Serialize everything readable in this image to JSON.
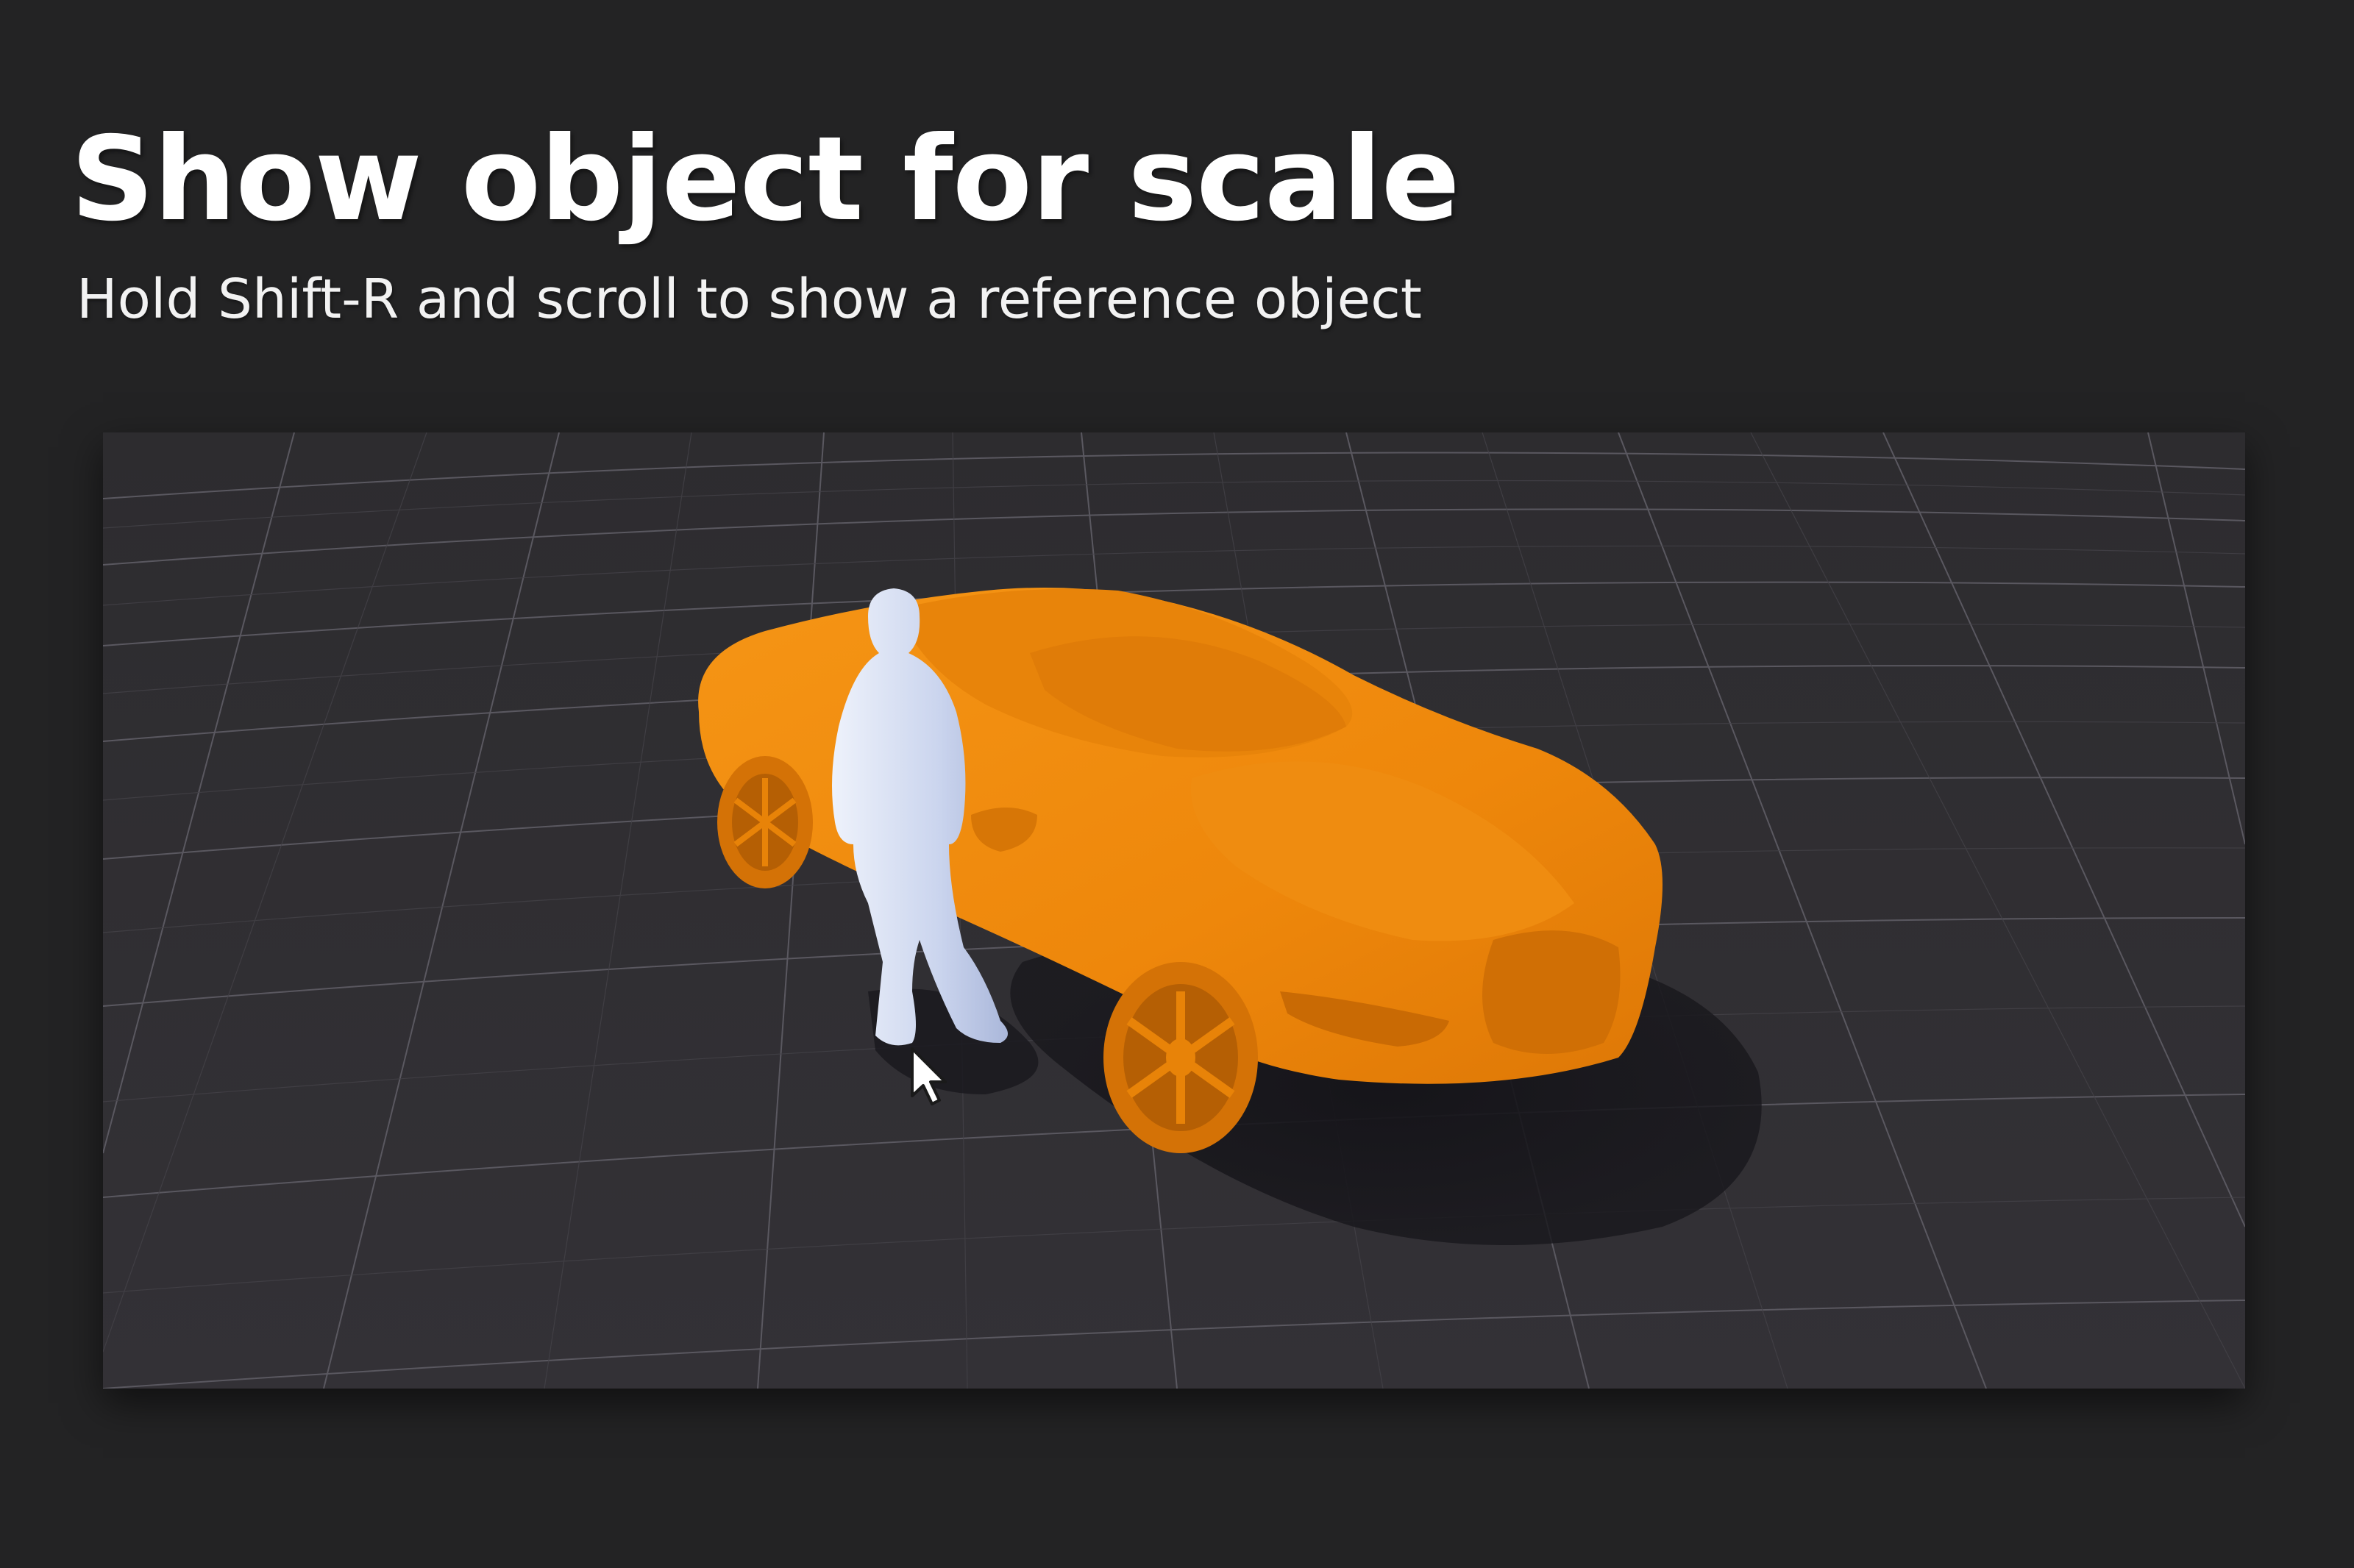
{
  "slide": {
    "title": "Show object for scale",
    "subtitle": "Hold Shift-R and scroll to show a reference object"
  },
  "viewport": {
    "grid": true,
    "model_color": "#ef8a0d",
    "reference_object": "human-figure",
    "reference_color": "#c9d3ec",
    "ground_color": "#302e33",
    "cursor": "arrow-cursor-icon"
  },
  "colors": {
    "background": "#232324",
    "title_text": "#ffffff",
    "subtitle_text": "#f2f2f2"
  }
}
